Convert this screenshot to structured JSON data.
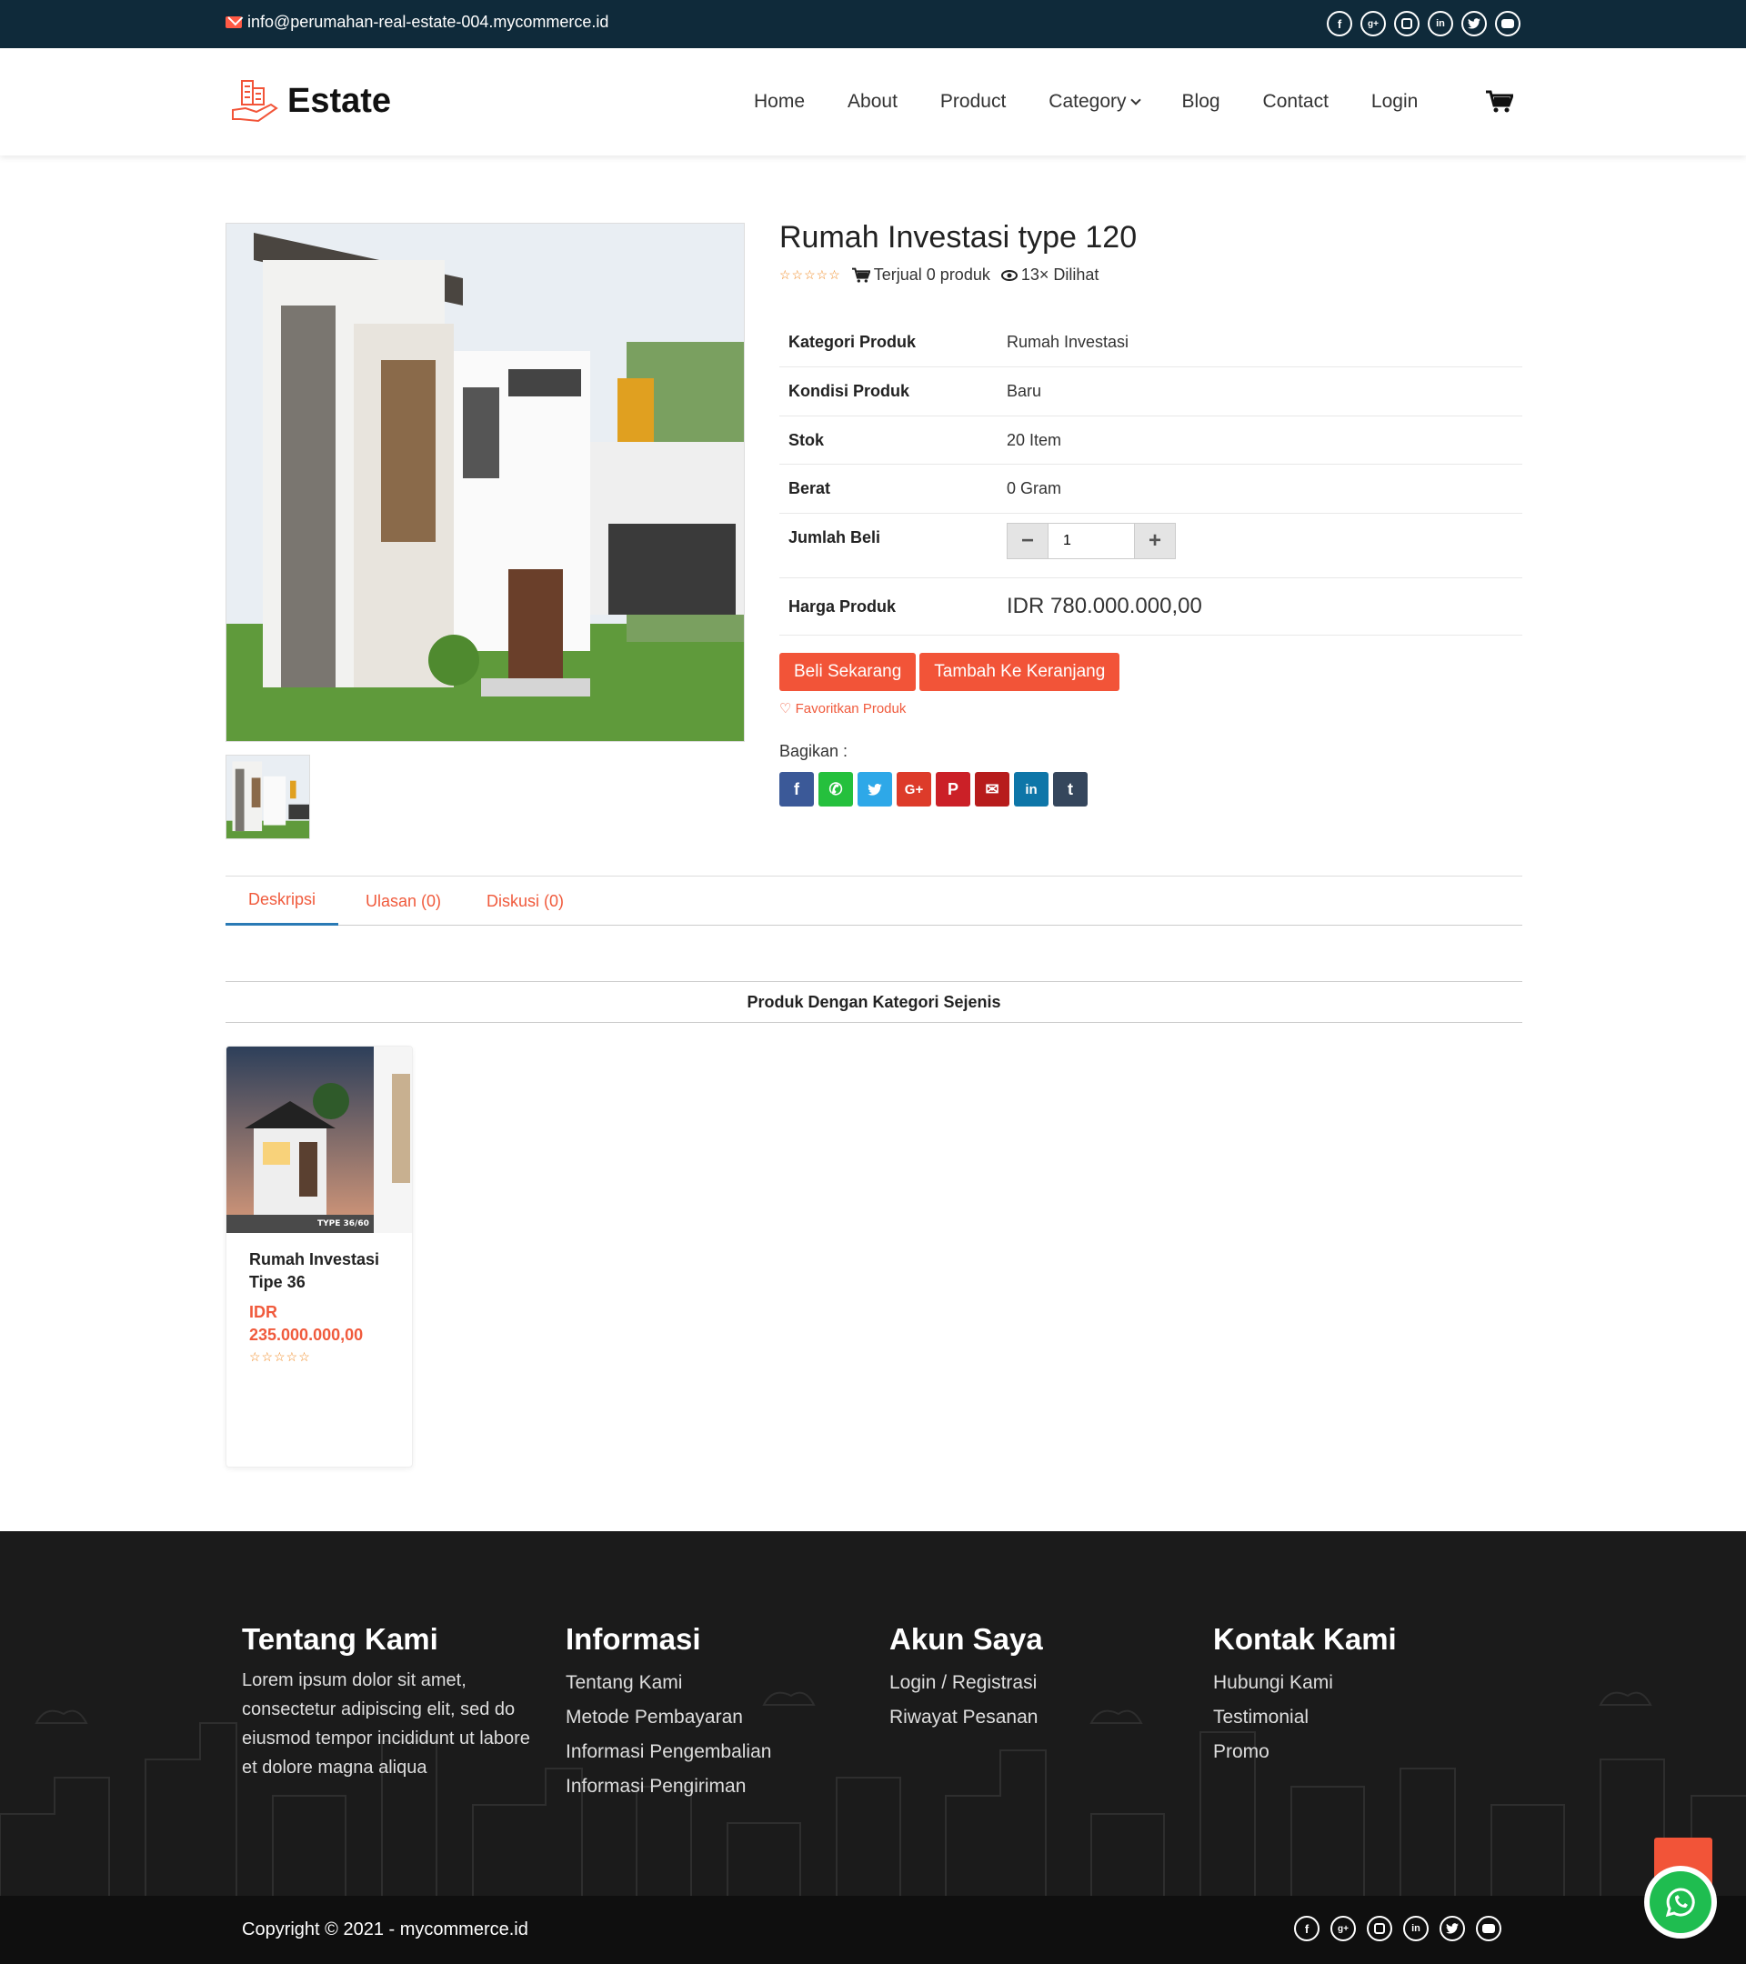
{
  "topbar": {
    "email": "info@perumahan-real-estate-004.mycommerce.id",
    "social_icons": [
      "facebook-icon",
      "google-plus-icon",
      "instagram-icon",
      "linkedin-icon",
      "twitter-icon",
      "youtube-icon"
    ]
  },
  "header": {
    "logo_text": "Estate",
    "nav": [
      "Home",
      "About",
      "Product",
      "Category",
      "Blog",
      "Contact",
      "Login"
    ]
  },
  "product": {
    "title": "Rumah Investasi type 120",
    "sold": "Terjual 0 produk",
    "views": "13× Dilihat",
    "rows": [
      {
        "label": "Kategori Produk",
        "value": "Rumah Investasi"
      },
      {
        "label": "Kondisi Produk",
        "value": "Baru"
      },
      {
        "label": "Stok",
        "value": "20 Item"
      },
      {
        "label": "Berat",
        "value": "0 Gram"
      },
      {
        "label": "Jumlah Beli",
        "value": "1"
      },
      {
        "label": "Harga Produk",
        "value": "IDR 780.000.000,00"
      }
    ],
    "buy_now": "Beli Sekarang",
    "add_cart": "Tambah Ke Keranjang",
    "favorite": "Favoritkan Produk",
    "share_label": "Bagikan :",
    "share_icons": [
      "facebook-icon",
      "whatsapp-icon",
      "twitter-icon",
      "google-plus-icon",
      "pinterest-icon",
      "email-icon",
      "linkedin-icon",
      "tumblr-icon"
    ]
  },
  "tabs": [
    "Deskripsi",
    "Ulasan (0)",
    "Diskusi (0)"
  ],
  "related": {
    "title": "Produk Dengan Kategori Sejenis",
    "items": [
      {
        "name": "Rumah Investasi Tipe 36",
        "price_currency": "IDR",
        "price_amount": "235.000.000,00",
        "img_label": "TYPE 36/60"
      }
    ]
  },
  "footer": {
    "cols": [
      {
        "title": "Tentang Kami",
        "text": "Lorem ipsum dolor sit amet, consectetur adipiscing elit, sed do eiusmod tempor incididunt ut labore et dolore magna aliqua"
      },
      {
        "title": "Informasi",
        "links": [
          "Tentang Kami",
          "Metode Pembayaran",
          "Informasi Pengembalian",
          "Informasi Pengiriman"
        ]
      },
      {
        "title": "Akun Saya",
        "links": [
          "Login / Registrasi",
          "Riwayat Pesanan"
        ]
      },
      {
        "title": "Kontak Kami",
        "links": [
          "Hubungi Kami",
          "Testimonial",
          "Promo"
        ]
      }
    ],
    "copyright": "Copyright © 2021 - mycommerce.id"
  },
  "colors": {
    "accent": "#f25438",
    "topbar": "#0f2a3a",
    "footer": "#1b1b1b"
  }
}
